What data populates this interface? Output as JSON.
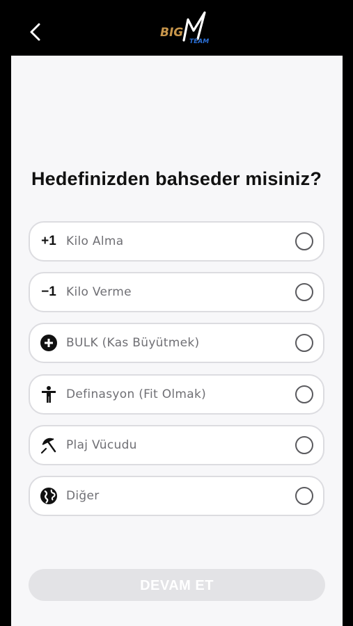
{
  "header": {
    "back_icon": "chevron-left-icon",
    "logo_text_big": "BIG",
    "logo_text_m": "M",
    "logo_text_team": "TEAM",
    "colors": {
      "logo_gold": "#c8964b",
      "logo_blue": "#2a6fd6"
    }
  },
  "main": {
    "question": "Hedefinizden bahseder misiniz?",
    "options": [
      {
        "icon_text": "+1",
        "icon": "plus-one-icon",
        "label": "Kilo Alma",
        "selected": false
      },
      {
        "icon_text": "−1",
        "icon": "minus-one-icon",
        "label": "Kilo Verme",
        "selected": false
      },
      {
        "icon_text": "",
        "icon": "plus-circle-icon",
        "label": "BULK (Kas Büyütmek)",
        "selected": false
      },
      {
        "icon_text": "",
        "icon": "person-icon",
        "label": "Definasyon (Fit Olmak)",
        "selected": false
      },
      {
        "icon_text": "",
        "icon": "beach-umbrella-icon",
        "label": "Plaj Vücudu",
        "selected": false
      },
      {
        "icon_text": "",
        "icon": "globe-icon",
        "label": "Diğer",
        "selected": false
      }
    ],
    "continue_label": "DEVAM ET",
    "continue_enabled": false
  }
}
